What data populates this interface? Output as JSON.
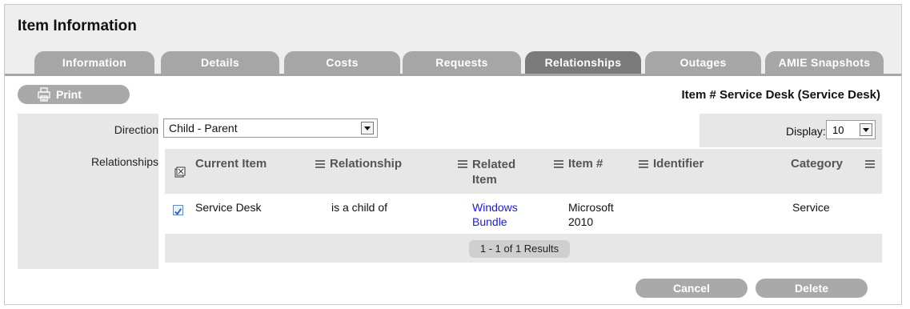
{
  "title": "Item Information",
  "tabs": [
    {
      "label": "Information"
    },
    {
      "label": "Details"
    },
    {
      "label": "Costs"
    },
    {
      "label": "Requests"
    },
    {
      "label": "Relationships",
      "active": true
    },
    {
      "label": "Outages"
    },
    {
      "label": "AMIE Snapshots"
    }
  ],
  "toolbar": {
    "print_label": "Print",
    "print_icon": "printer-icon"
  },
  "item_heading": "Item # Service Desk (Service Desk)",
  "form": {
    "direction_label": "Direction",
    "direction_value": "Child - Parent",
    "relationships_label": "Relationships",
    "display_label": "Display:",
    "display_value": "10"
  },
  "table": {
    "columns": {
      "current_item": "Current Item",
      "relationship": "Relationship",
      "related_item": "Related Item",
      "item_num": "Item #",
      "identifier": "Identifier",
      "category": "Category"
    },
    "rows": [
      {
        "checked": true,
        "current_item": "Service Desk",
        "relationship": "is a child of",
        "related_item": "Windows Bundle",
        "item_num": "Microsoft 2010",
        "identifier": "",
        "category": "Service"
      }
    ],
    "results": "1 - 1 of 1 Results"
  },
  "actions": {
    "cancel_label": "Cancel",
    "delete_label": "Delete"
  },
  "colors": {
    "tab": "#a6a6a6",
    "tab_active": "#7a7a7a",
    "link": "#1a1adf",
    "panel": "#e7e7e7"
  }
}
